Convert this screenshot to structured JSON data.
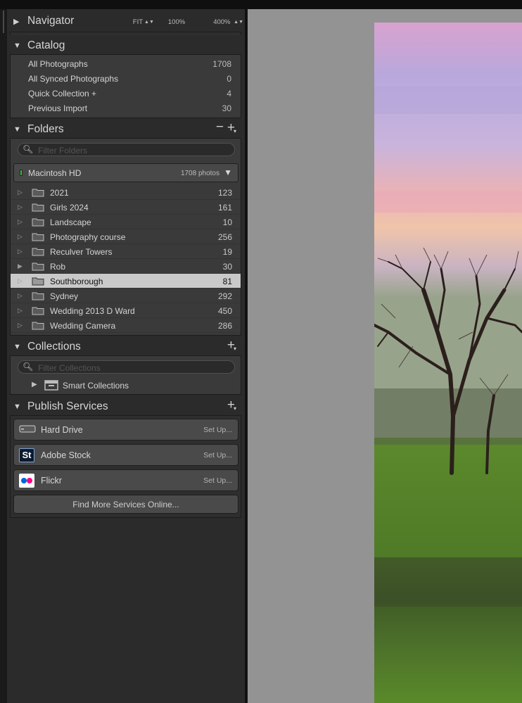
{
  "navigator": {
    "title": "Navigator",
    "options": [
      "FIT",
      "100%",
      "400%"
    ]
  },
  "catalog": {
    "title": "Catalog",
    "items": [
      {
        "label": "All Photographs",
        "count": "1708"
      },
      {
        "label": "All Synced Photographs",
        "count": "0"
      },
      {
        "label": "Quick Collection +",
        "count": "4"
      },
      {
        "label": "Previous Import",
        "count": "30"
      }
    ]
  },
  "folders": {
    "title": "Folders",
    "minus": "−",
    "plus": "+",
    "filter_placeholder": "Filter Folders",
    "volume": {
      "name": "Macintosh HD",
      "count": "1708 photos",
      "indicator_color": "#3dbb3d"
    },
    "items": [
      {
        "name": "2021",
        "count": "123",
        "expanded": false
      },
      {
        "name": "Girls 2024",
        "count": "161",
        "expanded": false
      },
      {
        "name": "Landscape",
        "count": "10",
        "expanded": false
      },
      {
        "name": "Photography course",
        "count": "256",
        "expanded": false
      },
      {
        "name": "Reculver Towers",
        "count": "19",
        "expanded": false
      },
      {
        "name": "Rob",
        "count": "30",
        "expanded": true
      },
      {
        "name": "Southborough",
        "count": "81",
        "selected": true
      },
      {
        "name": "Sydney",
        "count": "292"
      },
      {
        "name": "Wedding 2013 D Ward",
        "count": "450"
      },
      {
        "name": "Wedding Camera",
        "count": "286"
      }
    ]
  },
  "collections": {
    "title": "Collections",
    "plus": "+",
    "filter_placeholder": "Filter Collections",
    "items": [
      {
        "name": "Smart Collections"
      }
    ]
  },
  "publish": {
    "title": "Publish Services",
    "plus": "+",
    "services": [
      {
        "name": "Hard Drive",
        "action": "Set Up...",
        "icon": "hard-drive-icon"
      },
      {
        "name": "Adobe Stock",
        "action": "Set Up...",
        "icon": "adobe-stock-icon",
        "icon_text": "St"
      },
      {
        "name": "Flickr",
        "action": "Set Up...",
        "icon": "flickr-icon"
      }
    ],
    "find_more": "Find More Services Online..."
  },
  "colors": {
    "panel_bg": "#2b2b2b",
    "selected_row": "#c9c9c9",
    "main_bg": "#939393",
    "flickr_blue": "#0063dc",
    "flickr_pink": "#ff0084"
  }
}
